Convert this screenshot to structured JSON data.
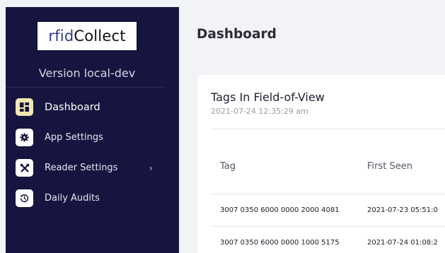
{
  "sidebar": {
    "logo": {
      "part1": "rfid",
      "part2": "Collect"
    },
    "version": "Version local-dev",
    "items": [
      {
        "label": "Dashboard",
        "icon": "dashboard-grid-icon",
        "active": true
      },
      {
        "label": "App Settings",
        "icon": "gear-icon",
        "active": false
      },
      {
        "label": "Reader Settings",
        "icon": "tools-icon",
        "active": false,
        "has_submenu": true
      },
      {
        "label": "Daily Audits",
        "icon": "history-icon",
        "active": false
      }
    ],
    "chevron": "›"
  },
  "main": {
    "title": "Dashboard",
    "card": {
      "title": "Tags In Field-of-View",
      "timestamp": "2021-07-24  12:35:29 am",
      "columns": [
        "Tag",
        "First Seen"
      ],
      "rows": [
        {
          "tag": "3007 0350 6000 0000 2000 4081",
          "first_seen": "2021-07-23  05:51:0"
        },
        {
          "tag": "3007 0350 6000 0000 1000 5175",
          "first_seen": "2021-07-24  01:08:2"
        }
      ]
    }
  },
  "colors": {
    "sidebar_bg": "#16153f",
    "active_icon_bg": "#f1e6b4",
    "page_bg": "#f2f3f7"
  }
}
